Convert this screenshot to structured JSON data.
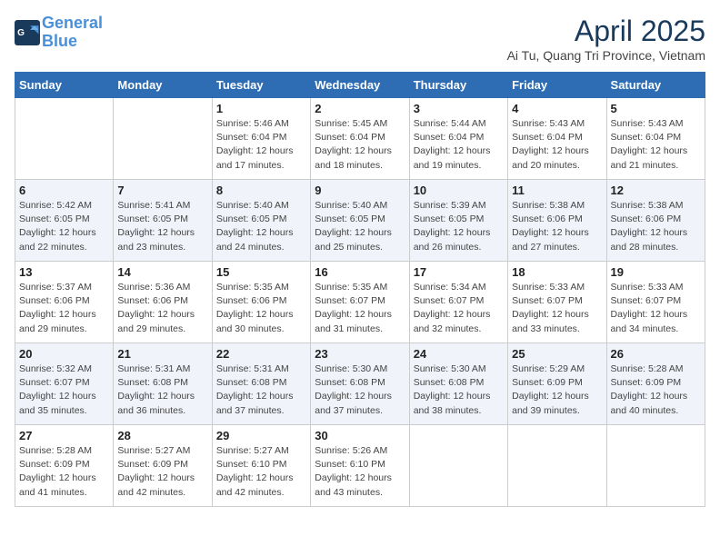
{
  "header": {
    "logo_line1": "General",
    "logo_line2": "Blue",
    "month_title": "April 2025",
    "location": "Ai Tu, Quang Tri Province, Vietnam"
  },
  "days_of_week": [
    "Sunday",
    "Monday",
    "Tuesday",
    "Wednesday",
    "Thursday",
    "Friday",
    "Saturday"
  ],
  "weeks": [
    [
      {
        "day": "",
        "sunrise": "",
        "sunset": "",
        "daylight": ""
      },
      {
        "day": "",
        "sunrise": "",
        "sunset": "",
        "daylight": ""
      },
      {
        "day": "1",
        "sunrise": "Sunrise: 5:46 AM",
        "sunset": "Sunset: 6:04 PM",
        "daylight": "Daylight: 12 hours and 17 minutes."
      },
      {
        "day": "2",
        "sunrise": "Sunrise: 5:45 AM",
        "sunset": "Sunset: 6:04 PM",
        "daylight": "Daylight: 12 hours and 18 minutes."
      },
      {
        "day": "3",
        "sunrise": "Sunrise: 5:44 AM",
        "sunset": "Sunset: 6:04 PM",
        "daylight": "Daylight: 12 hours and 19 minutes."
      },
      {
        "day": "4",
        "sunrise": "Sunrise: 5:43 AM",
        "sunset": "Sunset: 6:04 PM",
        "daylight": "Daylight: 12 hours and 20 minutes."
      },
      {
        "day": "5",
        "sunrise": "Sunrise: 5:43 AM",
        "sunset": "Sunset: 6:04 PM",
        "daylight": "Daylight: 12 hours and 21 minutes."
      }
    ],
    [
      {
        "day": "6",
        "sunrise": "Sunrise: 5:42 AM",
        "sunset": "Sunset: 6:05 PM",
        "daylight": "Daylight: 12 hours and 22 minutes."
      },
      {
        "day": "7",
        "sunrise": "Sunrise: 5:41 AM",
        "sunset": "Sunset: 6:05 PM",
        "daylight": "Daylight: 12 hours and 23 minutes."
      },
      {
        "day": "8",
        "sunrise": "Sunrise: 5:40 AM",
        "sunset": "Sunset: 6:05 PM",
        "daylight": "Daylight: 12 hours and 24 minutes."
      },
      {
        "day": "9",
        "sunrise": "Sunrise: 5:40 AM",
        "sunset": "Sunset: 6:05 PM",
        "daylight": "Daylight: 12 hours and 25 minutes."
      },
      {
        "day": "10",
        "sunrise": "Sunrise: 5:39 AM",
        "sunset": "Sunset: 6:05 PM",
        "daylight": "Daylight: 12 hours and 26 minutes."
      },
      {
        "day": "11",
        "sunrise": "Sunrise: 5:38 AM",
        "sunset": "Sunset: 6:06 PM",
        "daylight": "Daylight: 12 hours and 27 minutes."
      },
      {
        "day": "12",
        "sunrise": "Sunrise: 5:38 AM",
        "sunset": "Sunset: 6:06 PM",
        "daylight": "Daylight: 12 hours and 28 minutes."
      }
    ],
    [
      {
        "day": "13",
        "sunrise": "Sunrise: 5:37 AM",
        "sunset": "Sunset: 6:06 PM",
        "daylight": "Daylight: 12 hours and 29 minutes."
      },
      {
        "day": "14",
        "sunrise": "Sunrise: 5:36 AM",
        "sunset": "Sunset: 6:06 PM",
        "daylight": "Daylight: 12 hours and 29 minutes."
      },
      {
        "day": "15",
        "sunrise": "Sunrise: 5:35 AM",
        "sunset": "Sunset: 6:06 PM",
        "daylight": "Daylight: 12 hours and 30 minutes."
      },
      {
        "day": "16",
        "sunrise": "Sunrise: 5:35 AM",
        "sunset": "Sunset: 6:07 PM",
        "daylight": "Daylight: 12 hours and 31 minutes."
      },
      {
        "day": "17",
        "sunrise": "Sunrise: 5:34 AM",
        "sunset": "Sunset: 6:07 PM",
        "daylight": "Daylight: 12 hours and 32 minutes."
      },
      {
        "day": "18",
        "sunrise": "Sunrise: 5:33 AM",
        "sunset": "Sunset: 6:07 PM",
        "daylight": "Daylight: 12 hours and 33 minutes."
      },
      {
        "day": "19",
        "sunrise": "Sunrise: 5:33 AM",
        "sunset": "Sunset: 6:07 PM",
        "daylight": "Daylight: 12 hours and 34 minutes."
      }
    ],
    [
      {
        "day": "20",
        "sunrise": "Sunrise: 5:32 AM",
        "sunset": "Sunset: 6:07 PM",
        "daylight": "Daylight: 12 hours and 35 minutes."
      },
      {
        "day": "21",
        "sunrise": "Sunrise: 5:31 AM",
        "sunset": "Sunset: 6:08 PM",
        "daylight": "Daylight: 12 hours and 36 minutes."
      },
      {
        "day": "22",
        "sunrise": "Sunrise: 5:31 AM",
        "sunset": "Sunset: 6:08 PM",
        "daylight": "Daylight: 12 hours and 37 minutes."
      },
      {
        "day": "23",
        "sunrise": "Sunrise: 5:30 AM",
        "sunset": "Sunset: 6:08 PM",
        "daylight": "Daylight: 12 hours and 37 minutes."
      },
      {
        "day": "24",
        "sunrise": "Sunrise: 5:30 AM",
        "sunset": "Sunset: 6:08 PM",
        "daylight": "Daylight: 12 hours and 38 minutes."
      },
      {
        "day": "25",
        "sunrise": "Sunrise: 5:29 AM",
        "sunset": "Sunset: 6:09 PM",
        "daylight": "Daylight: 12 hours and 39 minutes."
      },
      {
        "day": "26",
        "sunrise": "Sunrise: 5:28 AM",
        "sunset": "Sunset: 6:09 PM",
        "daylight": "Daylight: 12 hours and 40 minutes."
      }
    ],
    [
      {
        "day": "27",
        "sunrise": "Sunrise: 5:28 AM",
        "sunset": "Sunset: 6:09 PM",
        "daylight": "Daylight: 12 hours and 41 minutes."
      },
      {
        "day": "28",
        "sunrise": "Sunrise: 5:27 AM",
        "sunset": "Sunset: 6:09 PM",
        "daylight": "Daylight: 12 hours and 42 minutes."
      },
      {
        "day": "29",
        "sunrise": "Sunrise: 5:27 AM",
        "sunset": "Sunset: 6:10 PM",
        "daylight": "Daylight: 12 hours and 42 minutes."
      },
      {
        "day": "30",
        "sunrise": "Sunrise: 5:26 AM",
        "sunset": "Sunset: 6:10 PM",
        "daylight": "Daylight: 12 hours and 43 minutes."
      },
      {
        "day": "",
        "sunrise": "",
        "sunset": "",
        "daylight": ""
      },
      {
        "day": "",
        "sunrise": "",
        "sunset": "",
        "daylight": ""
      },
      {
        "day": "",
        "sunrise": "",
        "sunset": "",
        "daylight": ""
      }
    ]
  ]
}
